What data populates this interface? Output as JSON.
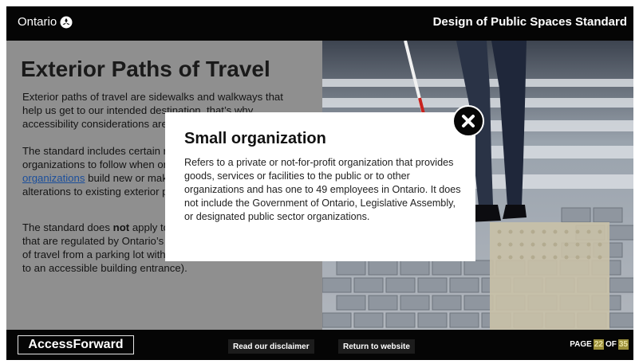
{
  "header": {
    "logo_text": "Ontario",
    "doc_title": "Design of Public Spaces Standard"
  },
  "content": {
    "title": "Exterior Paths of Travel",
    "para1": "Exterior paths of travel are sidewalks and walkways that help us get to our intended destination, that’s why accessibility considerations are important.",
    "para2_pre": "The standard includes certain requirements for organizations to follow when organizations except ",
    "para2_link": "small organizations",
    "para2_post": " build new or make planned significant alterations to existing exterior paths of travel.",
    "para3_pre": "The standard does ",
    "para3_bold": "not",
    "para3_post": " apply to exterior paths of travel that are regulated by Ontario’s Building Code (e.g. a path of travel from a parking lot with accessible parking spaces to an accessible building entrance)."
  },
  "modal": {
    "title": "Small organization",
    "body": "Refers to a private or not-for-profit organization that provides goods, services or facilities to the public or to other organizations and has one to 49 employees in Ontario. It does not include the Government of Ontario, Legislative Assembly, or designated public sector organizations.",
    "close_icon": "close-x-icon"
  },
  "footer": {
    "brand": "AccessForward",
    "disclaimer_label": "Read our disclaimer",
    "return_label": "Return to website",
    "page_label": "PAGE",
    "page_current": "22",
    "of_label": "OF",
    "page_total": "35"
  },
  "colors": {
    "bar": "#050505",
    "panel": "#8f8f8f",
    "link": "#1b4f9c",
    "page_highlight": "#9b8f3a"
  }
}
